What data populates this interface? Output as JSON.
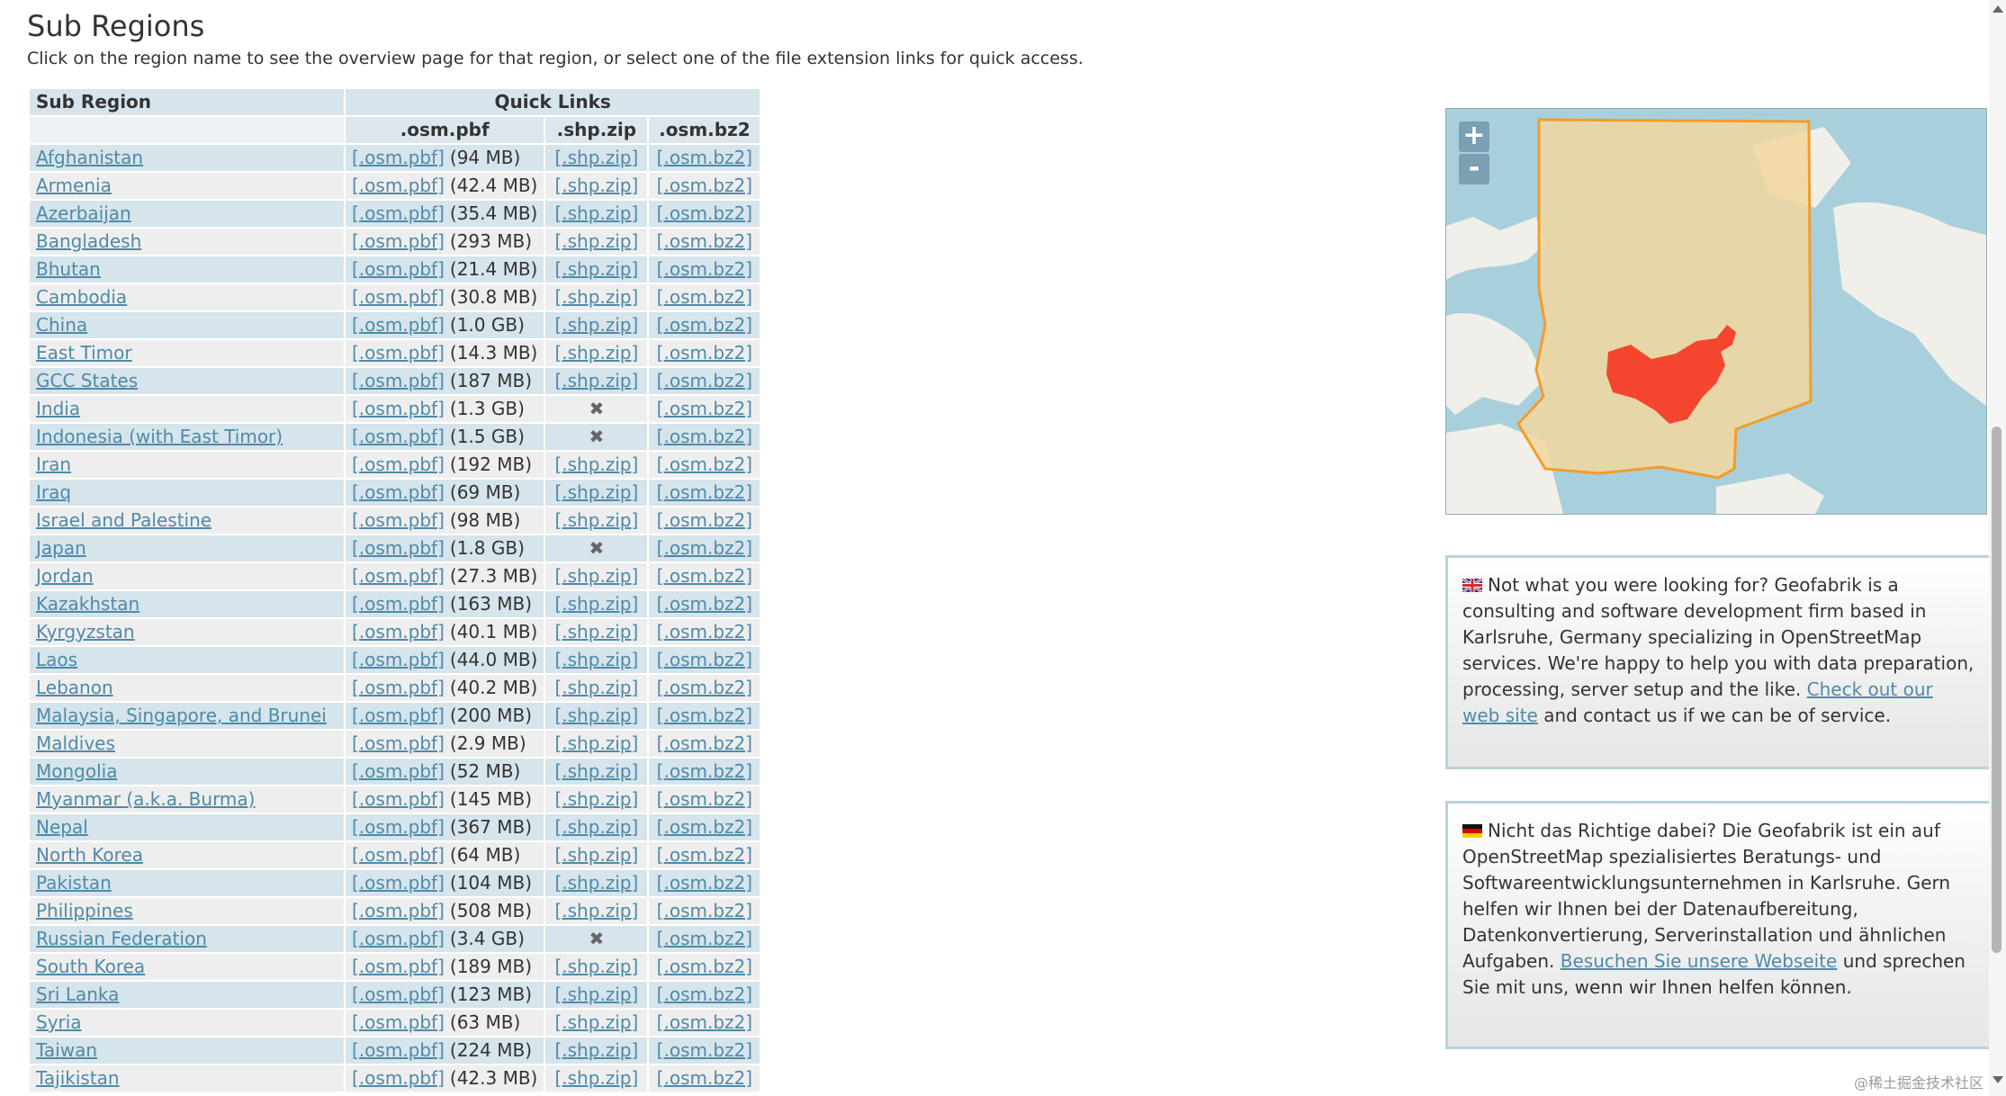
{
  "header": {
    "title": "Sub Regions",
    "intro": "Click on the region name to see the overview page for that region, or select one of the file extension links for quick access."
  },
  "table": {
    "col_sub_region": "Sub Region",
    "col_quick_links": "Quick Links",
    "col_pbf": ".osm.pbf",
    "col_shp": ".shp.zip",
    "col_bz2": ".osm.bz2",
    "pbf_link": "[.osm.pbf]",
    "shp_link": "[.shp.zip]",
    "bz2_link": "[.osm.bz2]",
    "no_shp_icon": "✖",
    "rows": [
      {
        "name": "Afghanistan",
        "size": "(94 MB)",
        "shp": true
      },
      {
        "name": "Armenia",
        "size": "(42.4 MB)",
        "shp": true
      },
      {
        "name": "Azerbaijan",
        "size": "(35.4 MB)",
        "shp": true
      },
      {
        "name": "Bangladesh",
        "size": "(293 MB)",
        "shp": true
      },
      {
        "name": "Bhutan",
        "size": "(21.4 MB)",
        "shp": true
      },
      {
        "name": "Cambodia",
        "size": "(30.8 MB)",
        "shp": true
      },
      {
        "name": "China",
        "size": "(1.0 GB)",
        "shp": true
      },
      {
        "name": "East Timor",
        "size": "(14.3 MB)",
        "shp": true
      },
      {
        "name": "GCC States",
        "size": "(187 MB)",
        "shp": true
      },
      {
        "name": "India",
        "size": "(1.3 GB)",
        "shp": false
      },
      {
        "name": "Indonesia (with East Timor)",
        "size": "(1.5 GB)",
        "shp": false
      },
      {
        "name": "Iran",
        "size": "(192 MB)",
        "shp": true
      },
      {
        "name": "Iraq",
        "size": "(69 MB)",
        "shp": true
      },
      {
        "name": "Israel and Palestine",
        "size": "(98 MB)",
        "shp": true
      },
      {
        "name": "Japan",
        "size": "(1.8 GB)",
        "shp": false
      },
      {
        "name": "Jordan",
        "size": "(27.3 MB)",
        "shp": true
      },
      {
        "name": "Kazakhstan",
        "size": "(163 MB)",
        "shp": true
      },
      {
        "name": "Kyrgyzstan",
        "size": "(40.1 MB)",
        "shp": true
      },
      {
        "name": "Laos",
        "size": "(44.0 MB)",
        "shp": true
      },
      {
        "name": "Lebanon",
        "size": "(40.2 MB)",
        "shp": true
      },
      {
        "name": "Malaysia, Singapore, and Brunei",
        "size": "(200 MB)",
        "shp": true
      },
      {
        "name": "Maldives",
        "size": "(2.9 MB)",
        "shp": true
      },
      {
        "name": "Mongolia",
        "size": "(52 MB)",
        "shp": true
      },
      {
        "name": "Myanmar (a.k.a. Burma)",
        "size": "(145 MB)",
        "shp": true
      },
      {
        "name": "Nepal",
        "size": "(367 MB)",
        "shp": true
      },
      {
        "name": "North Korea",
        "size": "(64 MB)",
        "shp": true
      },
      {
        "name": "Pakistan",
        "size": "(104 MB)",
        "shp": true
      },
      {
        "name": "Philippines",
        "size": "(508 MB)",
        "shp": true
      },
      {
        "name": "Russian Federation",
        "size": "(3.4 GB)",
        "shp": false
      },
      {
        "name": "South Korea",
        "size": "(189 MB)",
        "shp": true
      },
      {
        "name": "Sri Lanka",
        "size": "(123 MB)",
        "shp": true
      },
      {
        "name": "Syria",
        "size": "(63 MB)",
        "shp": true
      },
      {
        "name": "Taiwan",
        "size": "(224 MB)",
        "shp": true
      },
      {
        "name": "Tajikistan",
        "size": "(42.3 MB)",
        "shp": true
      }
    ]
  },
  "map": {
    "zoom_in": "+",
    "zoom_out": "-",
    "region_highlight_color": "#f4462f",
    "bounding_color": "#f39c2b"
  },
  "info_en": {
    "flag_icon": "uk-flag-icon",
    "text_before": "Not what you were looking for? Geofabrik is a consulting and software development firm based in Karlsruhe, Germany specializing in OpenStreetMap services. We're happy to help you with data preparation, processing, server setup and the like. ",
    "link": "Check out our web site",
    "text_after": " and contact us if we can be of service."
  },
  "info_de": {
    "flag_icon": "de-flag-icon",
    "text_before": "Nicht das Richtige dabei? Die Geofabrik ist ein auf OpenStreetMap spezialisiertes Beratungs- und Softwareentwicklungsunternehmen in Karlsruhe. Gern helfen wir Ihnen bei der Datenaufbereitung, Datenkonvertierung, Serverinstallation und ähnlichen Aufgaben. ",
    "link": "Besuchen Sie unsere Webseite",
    "text_after": " und sprechen Sie mit uns, wenn wir Ihnen helfen können."
  },
  "watermark": "@稀土掘金技术社区"
}
